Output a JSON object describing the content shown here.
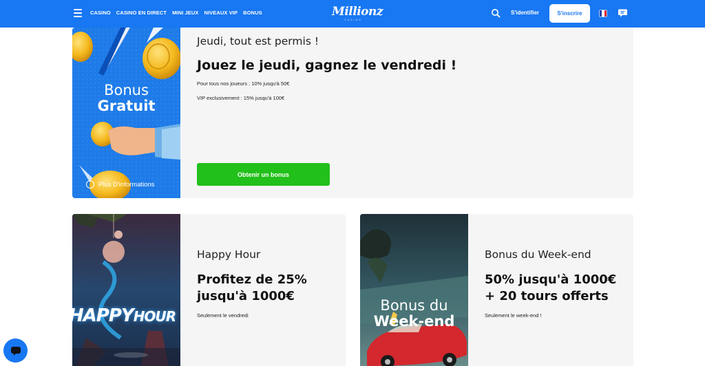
{
  "header": {
    "menu_icon": "hamburger-icon",
    "nav": [
      "CASINO",
      "CASINO EN DIRECT",
      "MINI JEUX",
      "NIVEAUX VIP",
      "BONUS"
    ],
    "logo_text": "Millionz",
    "logo_sub": "CASINO",
    "search_icon": "search-icon",
    "login_label": "S'identifier",
    "signup_label": "S'inscrire",
    "language_icon": "flag-fr-icon",
    "chat_icon": "chat-icon"
  },
  "promos": {
    "thursday": {
      "art_title_line1": "Bonus",
      "art_title_line2": "Gratuit",
      "more_info": "Plus D'informations",
      "kicker": "Jeudi, tout est permis !",
      "headline": "Jouez le jeudi, gagnez le vendredi !",
      "line1": "Pour tous nos joueurs : 10% jusqu'à 50€",
      "line2": "VIP exclusivement : 15% jusqu'à 100€",
      "cta": "Obtenir un bonus"
    },
    "happy_hour": {
      "art_title_a": "HAPPY",
      "art_title_b": "HOUR",
      "kicker": "Happy Hour",
      "headline_line1": "Profitez de 25%",
      "headline_line2": "jusqu'à 1000€",
      "note": "Seulement le vendredi"
    },
    "weekend": {
      "art_title_line1": "Bonus du",
      "art_title_line2": "Week-end",
      "kicker": "Bonus du Week-end",
      "headline_line1": "50% jusqu'à 1000€",
      "headline_line2": "+ 20 tours offerts",
      "note": "Seulement le week-end !"
    }
  },
  "floating_chat_icon": "chat-bubble-icon",
  "colors": {
    "header_bg": "#1877f2",
    "cta_green": "#22c01a",
    "card_bg": "#f5f5f5"
  }
}
